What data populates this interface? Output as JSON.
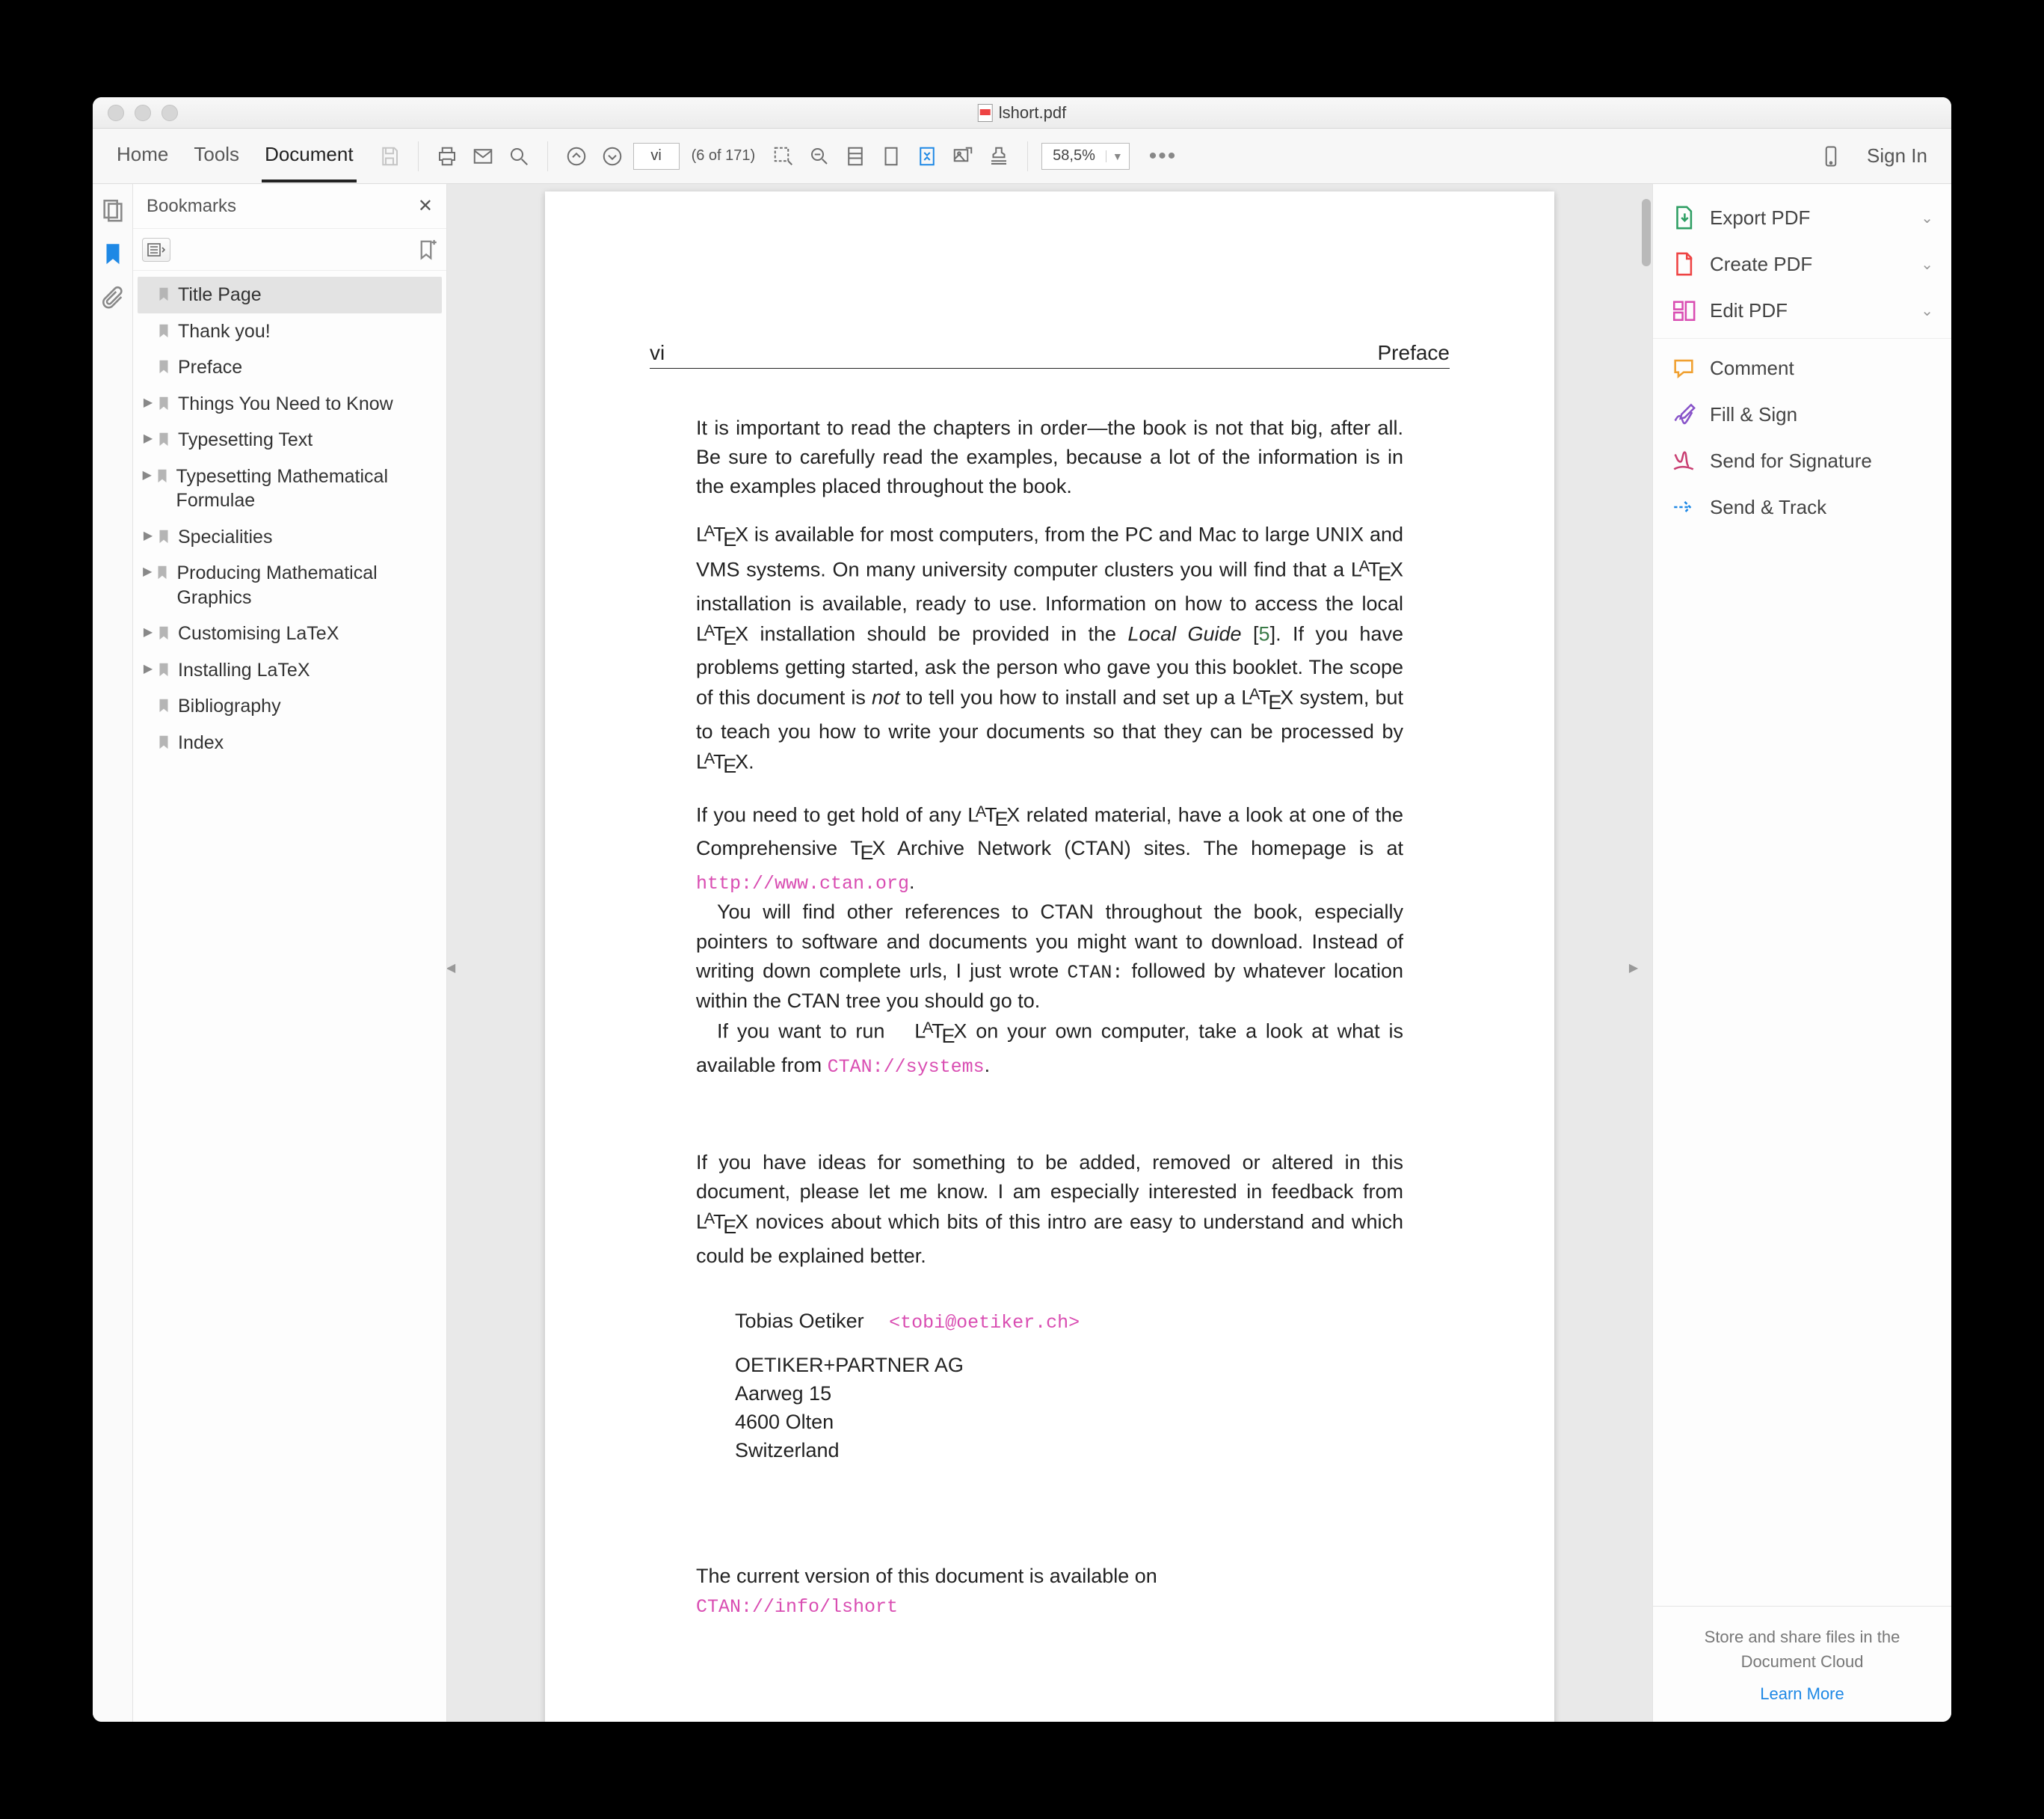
{
  "window": {
    "title": "lshort.pdf"
  },
  "tabs": {
    "home": "Home",
    "tools": "Tools",
    "document": "Document"
  },
  "toolbar": {
    "page_input": "vi",
    "page_count": "(6 of 171)",
    "zoom": "58,5%",
    "sign_in": "Sign In"
  },
  "bookmarks": {
    "header": "Bookmarks",
    "items": [
      {
        "label": "Title Page",
        "expandable": false,
        "selected": true
      },
      {
        "label": "Thank you!",
        "expandable": false
      },
      {
        "label": "Preface",
        "expandable": false
      },
      {
        "label": "Things You Need to Know",
        "expandable": true
      },
      {
        "label": "Typesetting Text",
        "expandable": true
      },
      {
        "label": "Typesetting Mathematical Formulae",
        "expandable": true
      },
      {
        "label": "Specialities",
        "expandable": true
      },
      {
        "label": "Producing Mathematical Graphics",
        "expandable": true
      },
      {
        "label": "Customising LaTeX",
        "expandable": true
      },
      {
        "label": "Installing LaTeX",
        "expandable": true
      },
      {
        "label": "Bibliography",
        "expandable": false
      },
      {
        "label": "Index",
        "expandable": false
      }
    ]
  },
  "page": {
    "num": "vi",
    "heading": "Preface",
    "p1": "It is important to read the chapters in order—the book is not that big, after all. Be sure to carefully read the examples, because a lot of the information is in the examples placed throughout the book.",
    "p2a": " is available for most computers, from the PC and Mac to large UNIX and VMS systems. On many university computer clusters you will find that a ",
    "p2b": " installation is available, ready to use. Information on how to access the local ",
    "p2c": " installation should be provided in the ",
    "p2_guide": "Local Guide",
    "p2d": " [",
    "p2_ref": "5",
    "p2e": "]. If you have problems getting started, ask the person who gave you this booklet. The scope of this document is ",
    "p2_not": "not",
    "p2f": " to tell you how to install and set up a ",
    "p2g": " system, but to teach you how to write your documents so that they can be processed by ",
    "p2h": ".",
    "p3a": "If you need to get hold of any ",
    "p3b": " related material, have a look at one of the Comprehensive ",
    "p3_tex": "TeX",
    "p3c": " Archive Network (CTAN) sites. The homepage is at ",
    "p3_url": "http://www.ctan.org",
    "p3d": ".",
    "p4a": "You will find other references to CTAN throughout the book, especially pointers to software and documents you might want to download. Instead of writing down complete urls, I just wrote ",
    "p4_ctan": "CTAN:",
    "p4b": " followed by whatever location within the CTAN tree you should go to.",
    "p5a": "If you want to run ",
    "p5b": " on your own computer, take a look at what is available from ",
    "p5_url": "CTAN://systems",
    "p5c": ".",
    "p6a": "If you have ideas for something to be added, removed or altered in this document, please let me know. I am especially interested in feedback from ",
    "p6b": " novices about which bits of this intro are easy to understand and which could be explained better.",
    "sig_name": "Tobias Oetiker",
    "sig_email": "<tobi@oetiker.ch>",
    "addr1": "OETIKER+PARTNER AG",
    "addr2": "Aarweg 15",
    "addr3": "4600 Olten",
    "addr4": "Switzerland",
    "version_line": "The current version of this document is available on",
    "version_url": "CTAN://info/lshort"
  },
  "right_panel": {
    "export": "Export PDF",
    "create": "Create PDF",
    "edit": "Edit PDF",
    "comment": "Comment",
    "fillsign": "Fill & Sign",
    "sendforsig": "Send for Signature",
    "sendtrack": "Send & Track",
    "footer_text": "Store and share files in the Document Cloud",
    "footer_link": "Learn More"
  }
}
